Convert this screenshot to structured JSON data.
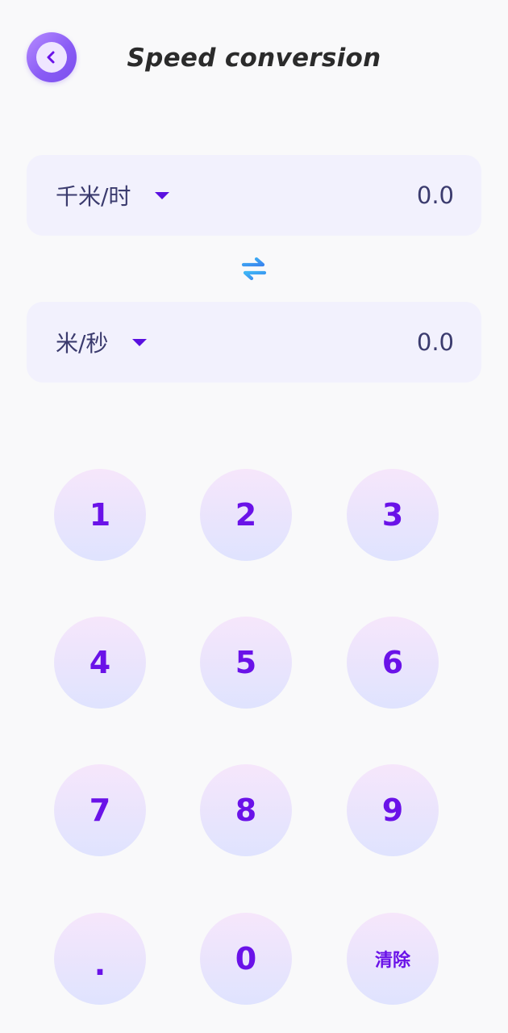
{
  "header": {
    "title": "Speed conversion"
  },
  "converter": {
    "from": {
      "unit": "千米/时",
      "value": "0.0"
    },
    "to": {
      "unit": "米/秒",
      "value": "0.0"
    }
  },
  "keypad": {
    "keys": [
      "1",
      "2",
      "3",
      "4",
      "5",
      "6",
      "7",
      "8",
      "9",
      ".",
      "0",
      "清除"
    ]
  },
  "colors": {
    "accent": "#6a12e8",
    "swap_icon": "#3aa0f0",
    "row_bg": "#f2f1fd"
  }
}
